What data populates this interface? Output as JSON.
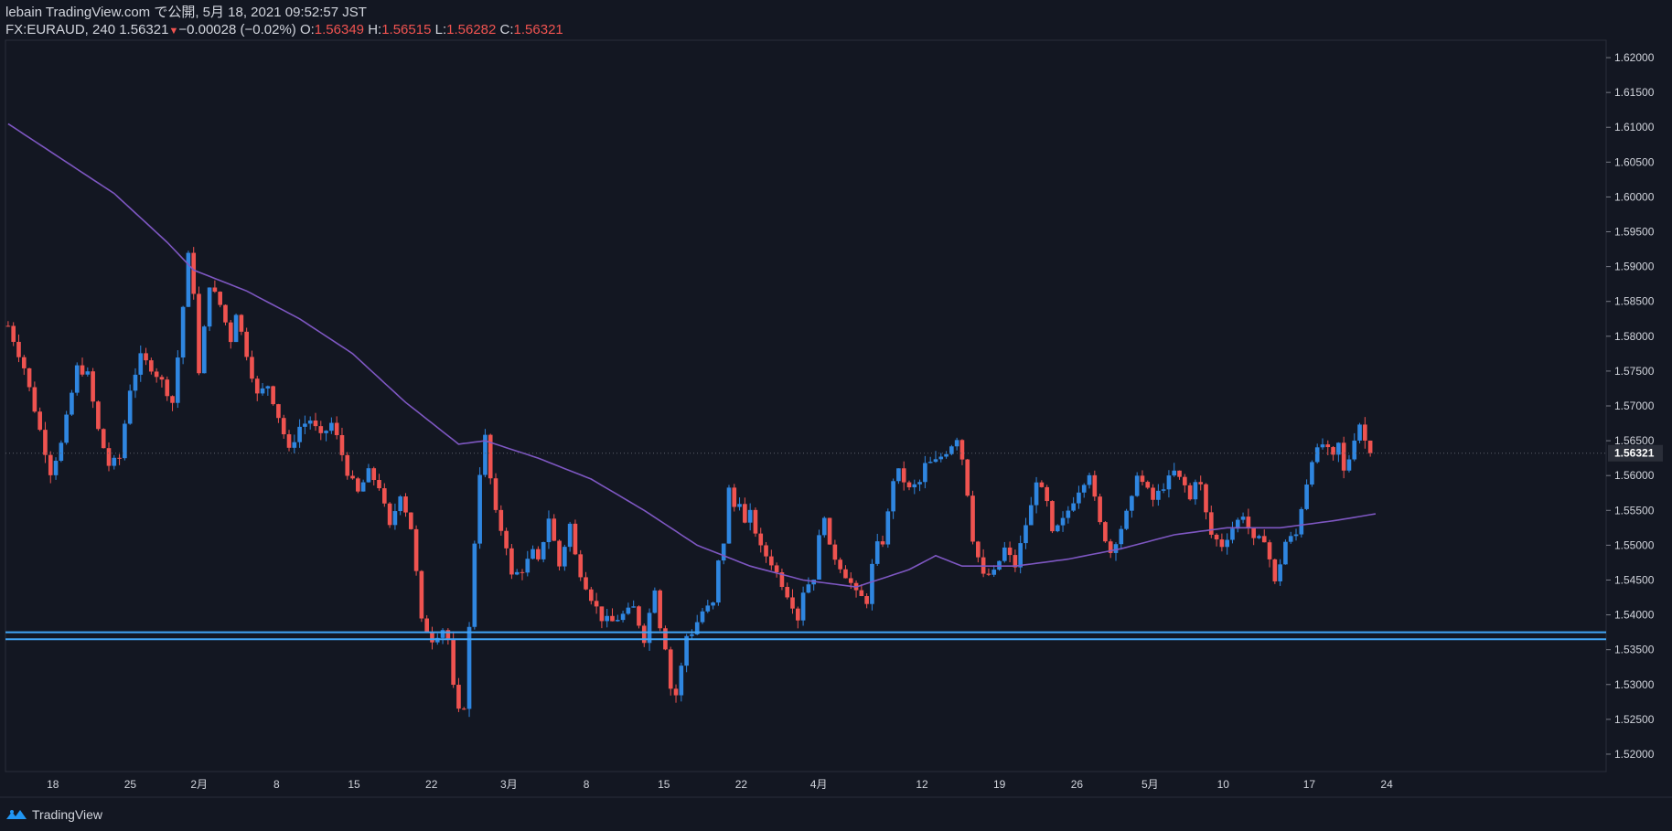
{
  "header": {
    "line1": "lebain TradingView.com で公開, 5月 18, 2021 09:52:57 JST",
    "symbol": "FX:EURAUD, 240",
    "last": "1.56321",
    "change_arrow": "▼",
    "change": "−0.00028 (−0.02%)",
    "o_label": "O:",
    "o": "1.56349",
    "h_label": "H:",
    "h": "1.56515",
    "l_label": "L:",
    "l": "1.56282",
    "c_label": "C:",
    "c": "1.56321"
  },
  "footer": {
    "brand": "TradingView"
  },
  "colors": {
    "background": "#131722",
    "up": "#2f86e0",
    "down": "#ef5350",
    "ma": "#7e57c2",
    "hline": "#42a5f5",
    "axis_text": "#d1d4dc",
    "grid": "#1e2230"
  },
  "chart_data": {
    "type": "candlestick",
    "symbol": "FX:EURAUD",
    "timeframe": "240",
    "ylim": [
      1.5175,
      1.6225
    ],
    "y_ticks": [
      1.52,
      1.525,
      1.53,
      1.535,
      1.54,
      1.545,
      1.55,
      1.555,
      1.56,
      1.565,
      1.57,
      1.575,
      1.58,
      1.585,
      1.59,
      1.595,
      1.6,
      1.605,
      1.61,
      1.615,
      1.62
    ],
    "last_price": 1.56321,
    "x_ticks": [
      "18",
      "25",
      "2月",
      "8",
      "15",
      "22",
      "3月",
      "8",
      "15",
      "22",
      "4月",
      "12",
      "19",
      "26",
      "5月",
      "10",
      "17",
      "24"
    ],
    "price_path": [
      [
        0,
        1.5815
      ],
      [
        3,
        1.5755
      ],
      [
        6,
        1.5665
      ],
      [
        8,
        1.5605
      ],
      [
        10,
        1.5645
      ],
      [
        13,
        1.5755
      ],
      [
        15,
        1.5745
      ],
      [
        17,
        1.5665
      ],
      [
        19,
        1.5615
      ],
      [
        21,
        1.5625
      ],
      [
        23,
        1.5725
      ],
      [
        25,
        1.577
      ],
      [
        27,
        1.5755
      ],
      [
        29,
        1.5735
      ],
      [
        31,
        1.5705
      ],
      [
        32,
        1.577
      ],
      [
        34,
        1.5915
      ],
      [
        35,
        1.5865
      ],
      [
        36,
        1.5745
      ],
      [
        38,
        1.5875
      ],
      [
        40,
        1.5845
      ],
      [
        42,
        1.5795
      ],
      [
        43,
        1.5835
      ],
      [
        45,
        1.5775
      ],
      [
        47,
        1.5715
      ],
      [
        49,
        1.573
      ],
      [
        51,
        1.5685
      ],
      [
        53,
        1.5635
      ],
      [
        55,
        1.567
      ],
      [
        57,
        1.568
      ],
      [
        59,
        1.5655
      ],
      [
        61,
        1.5675
      ],
      [
        62,
        1.5655
      ],
      [
        64,
        1.5605
      ],
      [
        66,
        1.5575
      ],
      [
        68,
        1.5605
      ],
      [
        70,
        1.5585
      ],
      [
        72,
        1.5525
      ],
      [
        74,
        1.5575
      ],
      [
        76,
        1.5525
      ],
      [
        77,
        1.546
      ],
      [
        78,
        1.539
      ],
      [
        80,
        1.5365
      ],
      [
        82,
        1.538
      ],
      [
        83,
        1.5365
      ],
      [
        84,
        1.5295
      ],
      [
        85,
        1.526
      ],
      [
        86,
        1.527
      ],
      [
        87,
        1.538
      ],
      [
        88,
        1.5505
      ],
      [
        89,
        1.5605
      ],
      [
        90,
        1.5655
      ],
      [
        91,
        1.5595
      ],
      [
        92,
        1.5545
      ],
      [
        94,
        1.55
      ],
      [
        95,
        1.5455
      ],
      [
        97,
        1.5465
      ],
      [
        99,
        1.549
      ],
      [
        100,
        1.5475
      ],
      [
        102,
        1.554
      ],
      [
        103,
        1.5505
      ],
      [
        104,
        1.547
      ],
      [
        106,
        1.553
      ],
      [
        107,
        1.5485
      ],
      [
        108,
        1.546
      ],
      [
        110,
        1.5425
      ],
      [
        112,
        1.5395
      ],
      [
        114,
        1.539
      ],
      [
        116,
        1.54
      ],
      [
        118,
        1.541
      ],
      [
        120,
        1.5365
      ],
      [
        122,
        1.544
      ],
      [
        123,
        1.5385
      ],
      [
        124,
        1.5355
      ],
      [
        125,
        1.5295
      ],
      [
        126,
        1.5285
      ],
      [
        127,
        1.5325
      ],
      [
        128,
        1.537
      ],
      [
        129,
        1.5375
      ],
      [
        131,
        1.5405
      ],
      [
        133,
        1.5415
      ],
      [
        134,
        1.5475
      ],
      [
        135,
        1.5505
      ],
      [
        136,
        1.558
      ],
      [
        137,
        1.5555
      ],
      [
        138,
        1.5565
      ],
      [
        139,
        1.553
      ],
      [
        140,
        1.5545
      ],
      [
        142,
        1.5495
      ],
      [
        144,
        1.5475
      ],
      [
        146,
        1.5445
      ],
      [
        148,
        1.5415
      ],
      [
        149,
        1.5395
      ],
      [
        150,
        1.5435
      ],
      [
        152,
        1.5455
      ],
      [
        153,
        1.551
      ],
      [
        154,
        1.5545
      ],
      [
        155,
        1.5495
      ],
      [
        157,
        1.547
      ],
      [
        159,
        1.5445
      ],
      [
        160,
        1.543
      ],
      [
        162,
        1.542
      ],
      [
        163,
        1.547
      ],
      [
        164,
        1.55
      ],
      [
        165,
        1.5505
      ],
      [
        166,
        1.5545
      ],
      [
        167,
        1.5595
      ],
      [
        168,
        1.5605
      ],
      [
        170,
        1.558
      ],
      [
        172,
        1.559
      ],
      [
        173,
        1.5615
      ],
      [
        175,
        1.562
      ],
      [
        177,
        1.5635
      ],
      [
        179,
        1.5655
      ],
      [
        180,
        1.5625
      ],
      [
        181,
        1.5575
      ],
      [
        182,
        1.551
      ],
      [
        184,
        1.5455
      ],
      [
        186,
        1.546
      ],
      [
        188,
        1.5495
      ],
      [
        190,
        1.547
      ],
      [
        192,
        1.553
      ],
      [
        193,
        1.5555
      ],
      [
        194,
        1.5595
      ],
      [
        196,
        1.556
      ],
      [
        197,
        1.5515
      ],
      [
        199,
        1.5535
      ],
      [
        201,
        1.5565
      ],
      [
        202,
        1.558
      ],
      [
        204,
        1.5605
      ],
      [
        205,
        1.5565
      ],
      [
        206,
        1.553
      ],
      [
        208,
        1.549
      ],
      [
        210,
        1.5525
      ],
      [
        212,
        1.5565
      ],
      [
        213,
        1.5605
      ],
      [
        214,
        1.559
      ],
      [
        216,
        1.5565
      ],
      [
        218,
        1.5585
      ],
      [
        220,
        1.5605
      ],
      [
        222,
        1.5585
      ],
      [
        223,
        1.5565
      ],
      [
        224,
        1.5595
      ],
      [
        225,
        1.5585
      ],
      [
        226,
        1.5545
      ],
      [
        227,
        1.5515
      ],
      [
        229,
        1.55
      ],
      [
        231,
        1.5525
      ],
      [
        233,
        1.5545
      ],
      [
        235,
        1.5505
      ],
      [
        237,
        1.551
      ],
      [
        238,
        1.548
      ],
      [
        239,
        1.5445
      ],
      [
        240,
        1.5475
      ],
      [
        241,
        1.5505
      ],
      [
        243,
        1.5515
      ],
      [
        244,
        1.5555
      ],
      [
        245,
        1.559
      ],
      [
        246,
        1.5625
      ],
      [
        248,
        1.5645
      ],
      [
        250,
        1.5625
      ],
      [
        251,
        1.5645
      ],
      [
        252,
        1.5605
      ],
      [
        253,
        1.5625
      ],
      [
        254,
        1.5655
      ],
      [
        255,
        1.5675
      ],
      [
        256,
        1.565
      ],
      [
        257,
        1.5632
      ]
    ],
    "ma": {
      "series_color": "#7e57c2",
      "points": [
        [
          0,
          1.6105
        ],
        [
          10,
          1.6055
        ],
        [
          20,
          1.6005
        ],
        [
          30,
          1.5935
        ],
        [
          35,
          1.5895
        ],
        [
          45,
          1.5865
        ],
        [
          55,
          1.5825
        ],
        [
          65,
          1.5775
        ],
        [
          75,
          1.5705
        ],
        [
          85,
          1.5645
        ],
        [
          90,
          1.565
        ],
        [
          100,
          1.5625
        ],
        [
          110,
          1.5595
        ],
        [
          120,
          1.555
        ],
        [
          130,
          1.55
        ],
        [
          140,
          1.547
        ],
        [
          150,
          1.545
        ],
        [
          160,
          1.544
        ],
        [
          170,
          1.5465
        ],
        [
          175,
          1.5485
        ],
        [
          180,
          1.547
        ],
        [
          190,
          1.547
        ],
        [
          200,
          1.548
        ],
        [
          210,
          1.5495
        ],
        [
          220,
          1.5515
        ],
        [
          230,
          1.5525
        ],
        [
          240,
          1.5525
        ],
        [
          250,
          1.5535
        ],
        [
          258,
          1.5545
        ]
      ]
    },
    "horizontal_lines": [
      1.5375,
      1.5365
    ],
    "grid": false,
    "legend": "top-left"
  }
}
